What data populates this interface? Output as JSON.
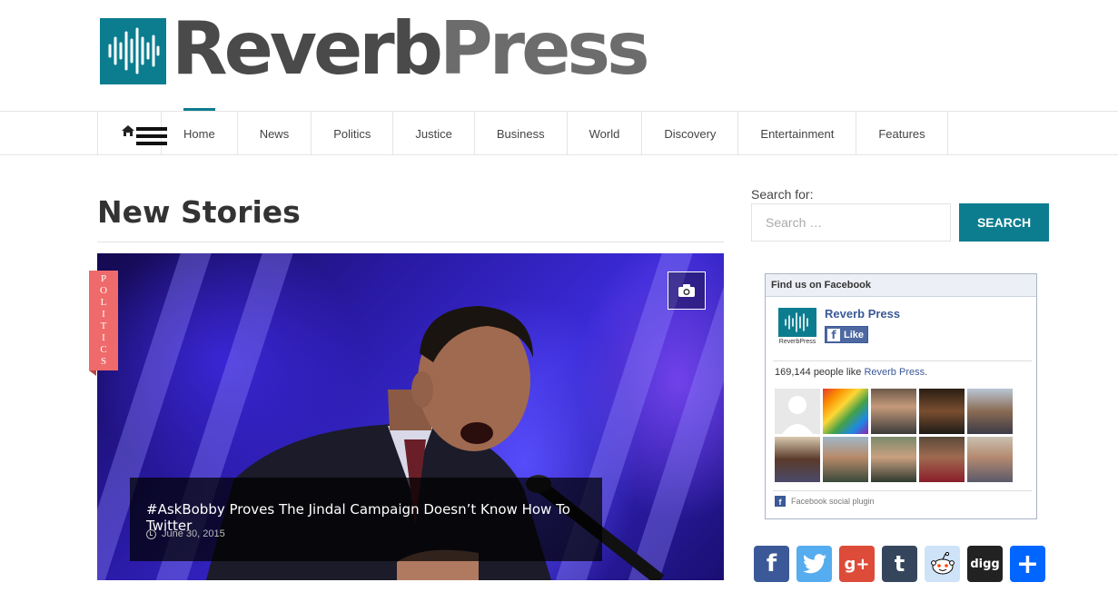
{
  "header": {
    "logo_reverb": "Reverb",
    "logo_press": "Press"
  },
  "nav": {
    "home_icon": "home-icon",
    "menu_icon": "hamburger-icon",
    "items": [
      {
        "label": "Home",
        "active": true
      },
      {
        "label": "News"
      },
      {
        "label": "Politics"
      },
      {
        "label": "Justice"
      },
      {
        "label": "Business"
      },
      {
        "label": "World"
      },
      {
        "label": "Discovery"
      },
      {
        "label": "Entertainment"
      },
      {
        "label": "Features"
      }
    ]
  },
  "main": {
    "section_title": "New Stories",
    "featured": {
      "category": "POLITICS",
      "title": "#AskBobby Proves The Jindal Campaign Doesn’t Know How To Twitter",
      "date": "June 30, 2015",
      "camera_icon": "camera-icon"
    }
  },
  "sidebar": {
    "search": {
      "label": "Search for:",
      "placeholder": "Search …",
      "button": "SEARCH"
    },
    "facebook": {
      "header": "Find us on Facebook",
      "page_name": "Reverb Press",
      "logo_caption": "ReverbPress",
      "like_label": "Like",
      "count_text": "169,144 people like ",
      "count_link": "Reverb Press",
      "count_end": ".",
      "plugin_label": "Facebook social plugin"
    },
    "share": [
      {
        "icon": "facebook-icon",
        "label": "f",
        "color": "#3b5998"
      },
      {
        "icon": "twitter-icon",
        "label": "🐦",
        "color": "#55acee"
      },
      {
        "icon": "google-plus-icon",
        "label": "g+",
        "color": "#dd4b39"
      },
      {
        "icon": "tumblr-icon",
        "label": "t",
        "color": "#35465c"
      },
      {
        "icon": "reddit-icon",
        "label": "👽",
        "color": "#cee3f8"
      },
      {
        "icon": "digg-icon",
        "label": "digg",
        "color": "#222222"
      },
      {
        "icon": "share-plus-icon",
        "label": "+",
        "color": "#0166ff"
      }
    ]
  },
  "colors": {
    "brand": "#0b7d8f",
    "category": "#ef6a6a",
    "facebook": "#3b5998"
  }
}
